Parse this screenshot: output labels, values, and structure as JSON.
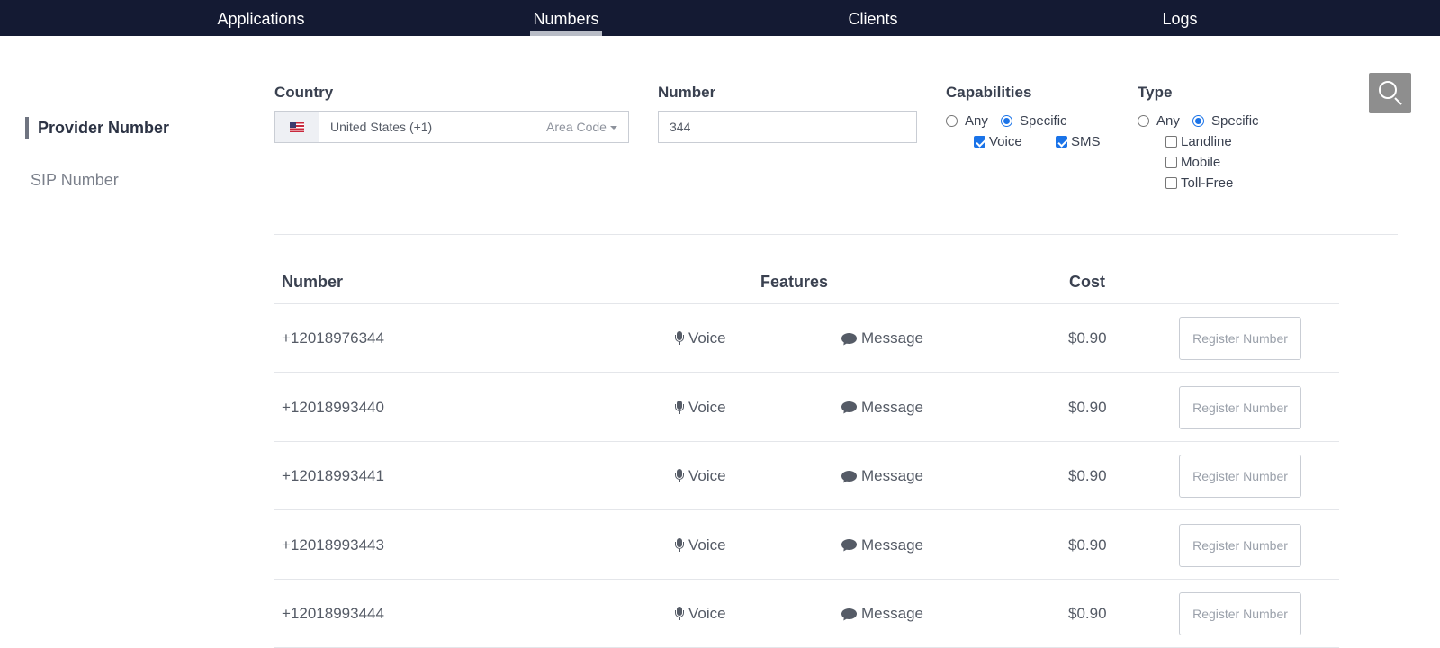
{
  "nav": {
    "items": [
      {
        "label": "Applications",
        "active": false
      },
      {
        "label": "Numbers",
        "active": true
      },
      {
        "label": "Clients",
        "active": false
      },
      {
        "label": "Logs",
        "active": false
      }
    ]
  },
  "sidebar": {
    "items": [
      {
        "label": "Provider Number",
        "active": true
      },
      {
        "label": "SIP Number",
        "active": false
      }
    ]
  },
  "filters": {
    "country": {
      "label": "Country",
      "value": "United States (+1)",
      "flag": "us-flag-icon",
      "area_code_label": "Area Code"
    },
    "number": {
      "label": "Number",
      "value": "344"
    },
    "capabilities": {
      "label": "Capabilities",
      "any_label": "Any",
      "specific_label": "Specific",
      "selected": "Specific",
      "voice_label": "Voice",
      "voice_checked": true,
      "sms_label": "SMS",
      "sms_checked": true
    },
    "type": {
      "label": "Type",
      "any_label": "Any",
      "specific_label": "Specific",
      "selected": "Specific",
      "landline_label": "Landline",
      "landline_checked": false,
      "mobile_label": "Mobile",
      "mobile_checked": false,
      "tollfree_label": "Toll-Free",
      "tollfree_checked": false
    },
    "search_icon": "search-icon"
  },
  "table": {
    "headers": {
      "number": "Number",
      "features": "Features",
      "cost": "Cost"
    },
    "rows": [
      {
        "number": "+12018976344",
        "voice": "Voice",
        "message": "Message",
        "cost": "$0.90",
        "action": "Register Number"
      },
      {
        "number": "+12018993440",
        "voice": "Voice",
        "message": "Message",
        "cost": "$0.90",
        "action": "Register Number"
      },
      {
        "number": "+12018993441",
        "voice": "Voice",
        "message": "Message",
        "cost": "$0.90",
        "action": "Register Number"
      },
      {
        "number": "+12018993443",
        "voice": "Voice",
        "message": "Message",
        "cost": "$0.90",
        "action": "Register Number"
      },
      {
        "number": "+12018993444",
        "voice": "Voice",
        "message": "Message",
        "cost": "$0.90",
        "action": "Register Number"
      }
    ]
  },
  "colors": {
    "nav_bg": "#141a33",
    "accent": "#1a73e8",
    "search_btn": "#8e8e8e"
  }
}
